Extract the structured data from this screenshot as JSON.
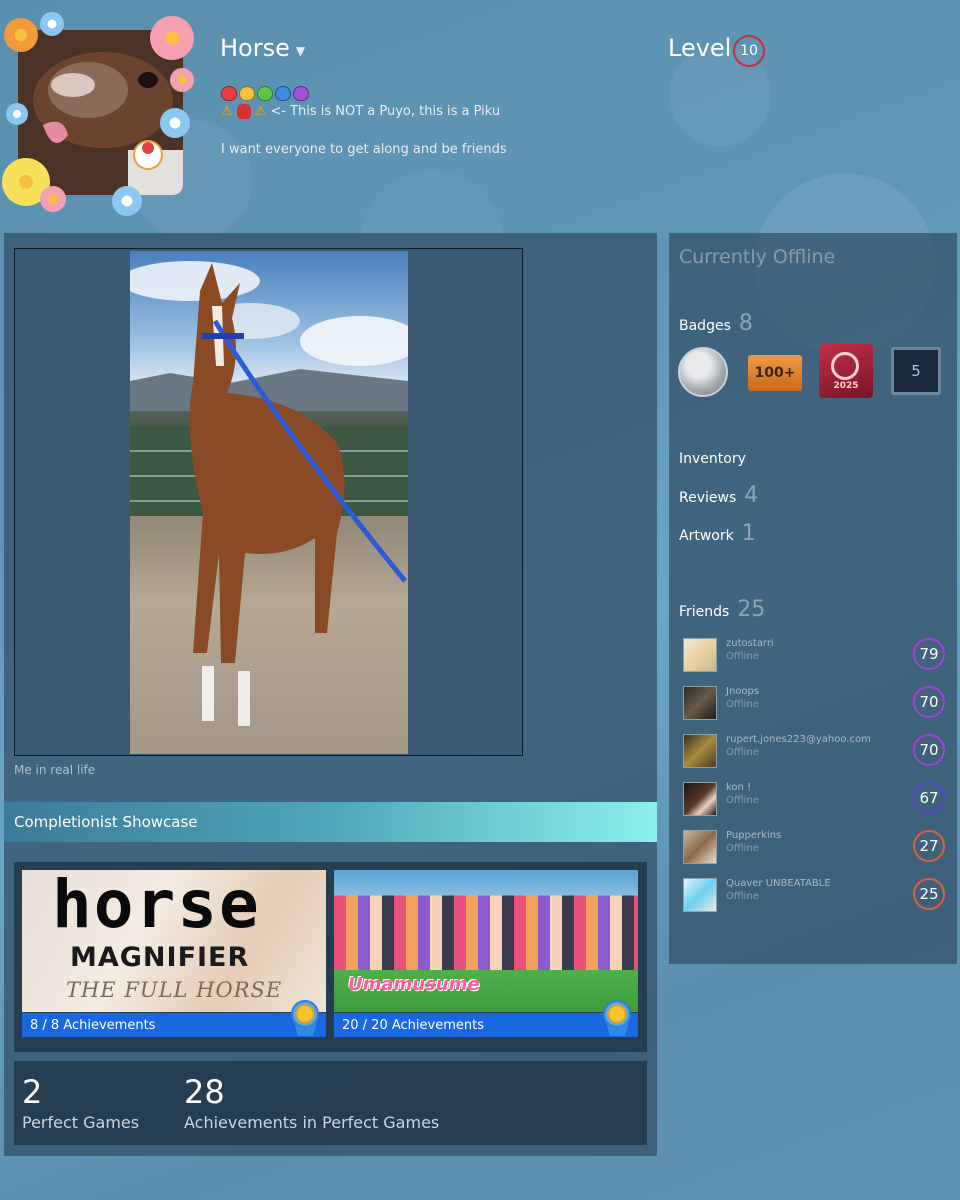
{
  "profile": {
    "name": "Horse",
    "status_line": "<- This is NOT a Puyo, this is a Piku",
    "summary": "I want everyone to get along and be friends",
    "level_label": "Level",
    "level": "10"
  },
  "artwork": {
    "caption": "Me in real life"
  },
  "showcase": {
    "title": "Completionist Showcase",
    "games": [
      {
        "art_line1": "horse",
        "art_line2": "MAGNIFIER",
        "art_line3": "THE FULL HORSE",
        "achievements": "8 / 8 Achievements"
      },
      {
        "art_logo": "Umamusume",
        "achievements": "20 / 20 Achievements"
      }
    ],
    "stats": [
      {
        "value": "2",
        "label": "Perfect Games"
      },
      {
        "value": "28",
        "label": "Achievements in Perfect Games"
      }
    ]
  },
  "sidebar": {
    "status": "Currently Offline",
    "badges_label": "Badges",
    "badges_count": "8",
    "badges": [
      {
        "icon": "years-of-service-badge-icon",
        "text": ""
      },
      {
        "icon": "hundred-plus-badge-icon",
        "text": "100+"
      },
      {
        "icon": "steam-2025-badge-icon",
        "text": "2025"
      },
      {
        "icon": "level-five-badge-icon",
        "text": "5"
      }
    ],
    "inventory_label": "Inventory",
    "reviews_label": "Reviews",
    "reviews_count": "4",
    "artwork_label": "Artwork",
    "artwork_count": "1",
    "friends_label": "Friends",
    "friends_count": "25",
    "friends": [
      {
        "name": "zutostarri",
        "status": "Offline",
        "level": "79",
        "ring": "#a341d8"
      },
      {
        "name": "Jnoops",
        "status": "Offline",
        "level": "70",
        "ring": "#a341d8"
      },
      {
        "name": "rupert.jones223@yahoo.com",
        "status": "Offline",
        "level": "70",
        "ring": "#a341d8"
      },
      {
        "name": "kon !",
        "status": "Offline",
        "level": "67",
        "ring": "#5a3ed0"
      },
      {
        "name": "Pupperkins",
        "status": "Offline",
        "level": "27",
        "ring": "#d8613c"
      },
      {
        "name": "Quaver UNBEATABLE",
        "status": "Offline",
        "level": "25",
        "ring": "#d8613c"
      }
    ]
  },
  "colors": {
    "level_ring": "#c52e3c",
    "achievement_bar": "#1a68e0"
  }
}
